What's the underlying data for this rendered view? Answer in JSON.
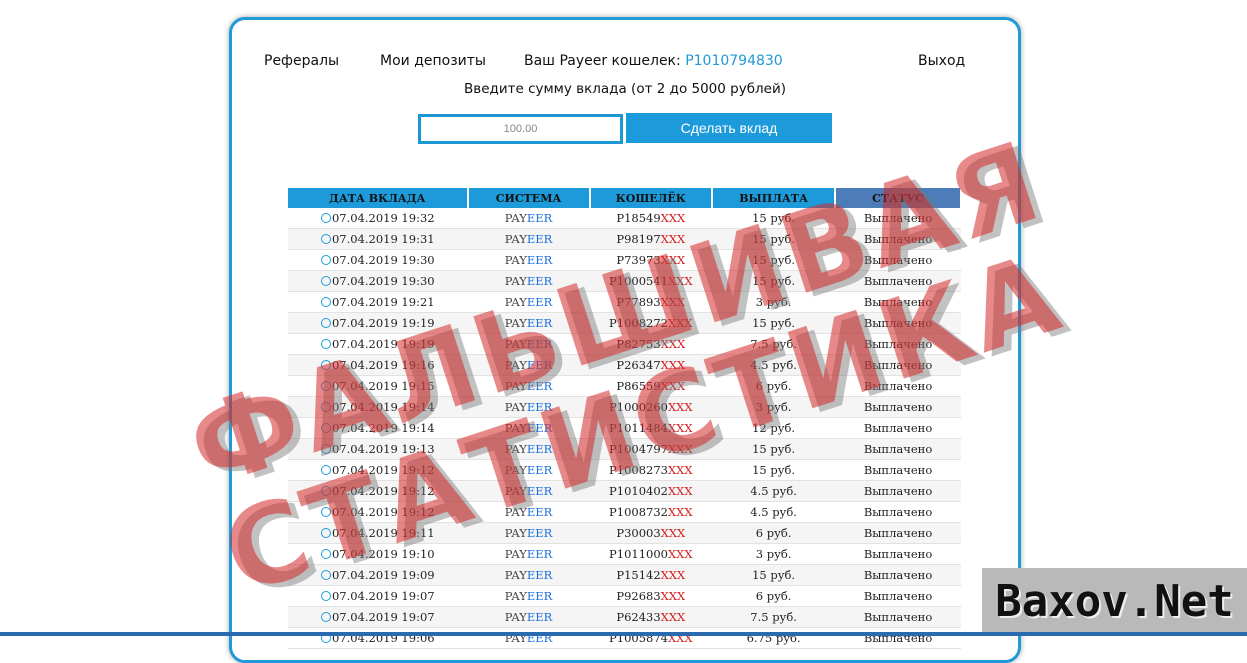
{
  "nav": {
    "referrals": "Рефералы",
    "deposits": "Мои депозиты",
    "wallet_label": "Ваш Payeer кошелек: ",
    "wallet_id": "P1010794830",
    "logout": "Выход"
  },
  "form": {
    "prompt": "Введите сумму вклада (от 2 до 5000 рублей)",
    "amount_value": "100.00",
    "submit_label": "Сделать вклад"
  },
  "table": {
    "headers": [
      "ДАТА ВКЛАДА",
      "СИСТЕМА",
      "КОШЕЛЁК",
      "ВЫПЛАТА",
      "СТАТУС"
    ],
    "rows": [
      {
        "date": "07.04.2019 19:32",
        "sys_a": "PAY",
        "sys_b": "EER",
        "wallet": "P18549",
        "mask": "XXX",
        "amount": "15 руб.",
        "status": "Выплачено"
      },
      {
        "date": "07.04.2019 19:31",
        "sys_a": "PAY",
        "sys_b": "EER",
        "wallet": "P98197",
        "mask": "XXX",
        "amount": "15 руб.",
        "status": "Выплачено"
      },
      {
        "date": "07.04.2019 19:30",
        "sys_a": "PAY",
        "sys_b": "EER",
        "wallet": "P73973",
        "mask": "XXX",
        "amount": "15 руб.",
        "status": "Выплачено"
      },
      {
        "date": "07.04.2019 19:30",
        "sys_a": "PAY",
        "sys_b": "EER",
        "wallet": "P1000541",
        "mask": "XXX",
        "amount": "15 руб.",
        "status": "Выплачено"
      },
      {
        "date": "07.04.2019 19:21",
        "sys_a": "PAY",
        "sys_b": "EER",
        "wallet": "P77893",
        "mask": "XXX",
        "amount": "3 руб.",
        "status": "Выплачено"
      },
      {
        "date": "07.04.2019 19:19",
        "sys_a": "PAY",
        "sys_b": "EER",
        "wallet": "P1008272",
        "mask": "XXX",
        "amount": "15 руб.",
        "status": "Выплачено"
      },
      {
        "date": "07.04.2019 19:19",
        "sys_a": "PAY",
        "sys_b": "EER",
        "wallet": "P82753",
        "mask": "XXX",
        "amount": "7.5 руб.",
        "status": "Выплачено"
      },
      {
        "date": "07.04.2019 19:16",
        "sys_a": "PAY",
        "sys_b": "EER",
        "wallet": "P26347",
        "mask": "XXX",
        "amount": "4.5 руб.",
        "status": "Выплачено"
      },
      {
        "date": "07.04.2019 19:15",
        "sys_a": "PAY",
        "sys_b": "EER",
        "wallet": "P86559",
        "mask": "XXX",
        "amount": "6 руб.",
        "status": "Выплачено"
      },
      {
        "date": "07.04.2019 19:14",
        "sys_a": "PAY",
        "sys_b": "EER",
        "wallet": "P1000260",
        "mask": "XXX",
        "amount": "3 руб.",
        "status": "Выплачено"
      },
      {
        "date": "07.04.2019 19:14",
        "sys_a": "PAY",
        "sys_b": "EER",
        "wallet": "P1011484",
        "mask": "XXX",
        "amount": "12 руб.",
        "status": "Выплачено"
      },
      {
        "date": "07.04.2019 19:13",
        "sys_a": "PAY",
        "sys_b": "EER",
        "wallet": "P1004797",
        "mask": "XXX",
        "amount": "15 руб.",
        "status": "Выплачено"
      },
      {
        "date": "07.04.2019 19:12",
        "sys_a": "PAY",
        "sys_b": "EER",
        "wallet": "P1008273",
        "mask": "XXX",
        "amount": "15 руб.",
        "status": "Выплачено"
      },
      {
        "date": "07.04.2019 19:12",
        "sys_a": "PAY",
        "sys_b": "EER",
        "wallet": "P1010402",
        "mask": "XXX",
        "amount": "4.5 руб.",
        "status": "Выплачено"
      },
      {
        "date": "07.04.2019 19:12",
        "sys_a": "PAY",
        "sys_b": "EER",
        "wallet": "P1008732",
        "mask": "XXX",
        "amount": "4.5 руб.",
        "status": "Выплачено"
      },
      {
        "date": "07.04.2019 19:11",
        "sys_a": "PAY",
        "sys_b": "EER",
        "wallet": "P30003",
        "mask": "XXX",
        "amount": "6 руб.",
        "status": "Выплачено"
      },
      {
        "date": "07.04.2019 19:10",
        "sys_a": "PAY",
        "sys_b": "EER",
        "wallet": "P1011000",
        "mask": "XXX",
        "amount": "3 руб.",
        "status": "Выплачено"
      },
      {
        "date": "07.04.2019 19:09",
        "sys_a": "PAY",
        "sys_b": "EER",
        "wallet": "P15142",
        "mask": "XXX",
        "amount": "15 руб.",
        "status": "Выплачено"
      },
      {
        "date": "07.04.2019 19:07",
        "sys_a": "PAY",
        "sys_b": "EER",
        "wallet": "P92683",
        "mask": "XXX",
        "amount": "6 руб.",
        "status": "Выплачено"
      },
      {
        "date": "07.04.2019 19:07",
        "sys_a": "PAY",
        "sys_b": "EER",
        "wallet": "P62433",
        "mask": "XXX",
        "amount": "7.5 руб.",
        "status": "Выплачено"
      },
      {
        "date": "07.04.2019 19:06",
        "sys_a": "PAY",
        "sys_b": "EER",
        "wallet": "P1005874",
        "mask": "XXX",
        "amount": "6.75 руб.",
        "status": "Выплачено"
      }
    ]
  },
  "overlay": {
    "stamp_line1": "ФАЛЬШИВАЯ",
    "stamp_line2": "СТАТИСТИКА",
    "watermark": "Baxov.Net"
  },
  "colors": {
    "accent": "#1c9ad9",
    "mask": "#d42020",
    "paid": "#2b9a2b",
    "stamp": "#d62828"
  }
}
